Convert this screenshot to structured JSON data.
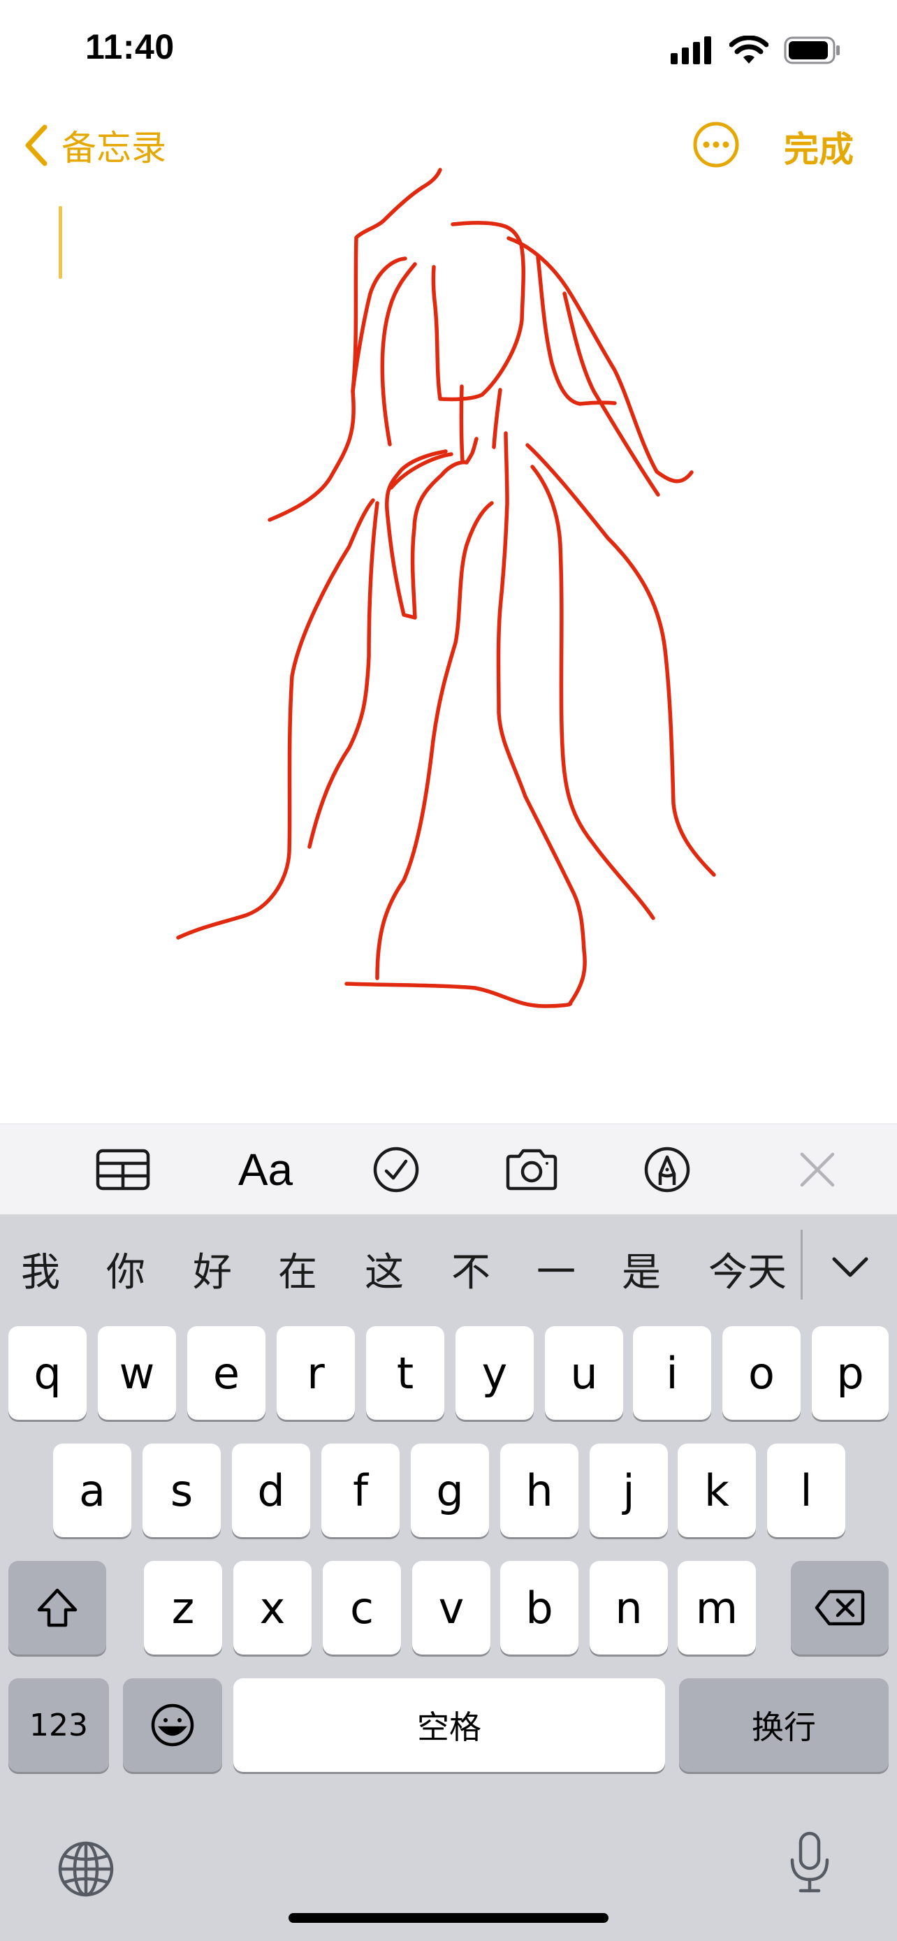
{
  "status_bar": {
    "time": "11:40"
  },
  "nav": {
    "back_label": "备忘录",
    "done_label": "完成"
  },
  "toolbar": {
    "format_label": "Aa"
  },
  "keyboard": {
    "candidates": [
      "我",
      "你",
      "好",
      "在",
      "这",
      "不",
      "一",
      "是",
      "今天"
    ],
    "row1": [
      "q",
      "w",
      "e",
      "r",
      "t",
      "y",
      "u",
      "i",
      "o",
      "p"
    ],
    "row2": [
      "a",
      "s",
      "d",
      "f",
      "g",
      "h",
      "j",
      "k",
      "l"
    ],
    "row3": [
      "z",
      "x",
      "c",
      "v",
      "b",
      "n",
      "m"
    ],
    "numbers_label": "123",
    "space_label": "空格",
    "return_label": "换行"
  },
  "colors": {
    "accent": "#e5a702",
    "ink": "#e0290e",
    "keyboard_bg": "#d2d4da",
    "toolbar_bg": "#f3f3f5"
  },
  "icons": [
    "signal-icon",
    "wifi-icon",
    "battery-icon",
    "chevron-left-icon",
    "more-icon",
    "table-icon",
    "checklist-icon",
    "camera-icon",
    "markup-pen-icon",
    "close-icon",
    "chevron-down-icon",
    "shift-icon",
    "delete-icon",
    "emoji-icon",
    "globe-icon",
    "microphone-icon"
  ]
}
